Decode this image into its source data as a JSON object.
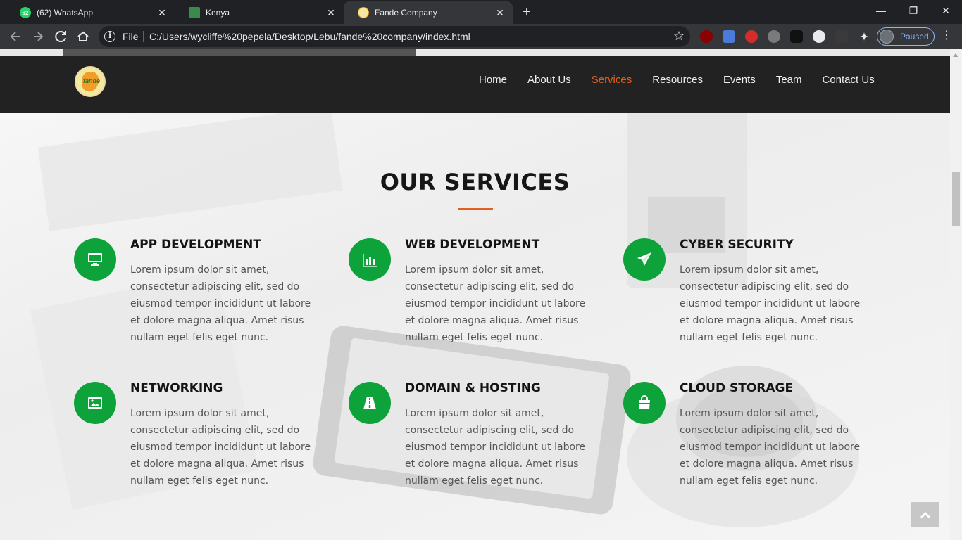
{
  "browser": {
    "tabs": [
      {
        "title": "(62) WhatsApp",
        "favicon": "whatsapp-icon",
        "badge": "62",
        "active": false
      },
      {
        "title": "Kenya",
        "favicon": "kenya-icon",
        "active": false
      },
      {
        "title": "Fande Company",
        "favicon": "fande-icon",
        "active": true
      }
    ],
    "new_tab": "+",
    "window_controls": {
      "minimize": "—",
      "restore": "❐",
      "close": "✕"
    },
    "omnibox": {
      "scheme_label": "File",
      "url": "C:/Users/wycliffe%20pepela/Desktop/Lebu/fande%20company/index.html"
    },
    "profile": {
      "status": "Paused"
    }
  },
  "site": {
    "nav": {
      "items": [
        "Home",
        "About Us",
        "Services",
        "Resources",
        "Events",
        "Team",
        "Contact Us"
      ],
      "active": "Services"
    },
    "logo_text": "fande",
    "section_title": "OUR SERVICES",
    "services": [
      {
        "title": "APP DEVELOPMENT",
        "icon": "monitor-icon",
        "text": "Lorem ipsum dolor sit amet, consectetur adipiscing elit, sed do eiusmod tempor incididunt ut labore et dolore magna aliqua. Amet risus nullam eget felis eget nunc."
      },
      {
        "title": "WEB DEVELOPMENT",
        "icon": "bar-chart-icon",
        "text": "Lorem ipsum dolor sit amet, consectetur adipiscing elit, sed do eiusmod tempor incididunt ut labore et dolore magna aliqua. Amet risus nullam eget felis eget nunc."
      },
      {
        "title": "CYBER SECURITY",
        "icon": "paper-plane-icon",
        "text": "Lorem ipsum dolor sit amet, consectetur adipiscing elit, sed do eiusmod tempor incididunt ut labore et dolore magna aliqua. Amet risus nullam eget felis eget nunc."
      },
      {
        "title": "NETWORKING",
        "icon": "image-icon",
        "text": "Lorem ipsum dolor sit amet, consectetur adipiscing elit, sed do eiusmod tempor incididunt ut labore et dolore magna aliqua. Amet risus nullam eget felis eget nunc."
      },
      {
        "title": "DOMAIN & HOSTING",
        "icon": "road-icon",
        "text": "Lorem ipsum dolor sit amet, consectetur adipiscing elit, sed do eiusmod tempor incididunt ut labore et dolore magna aliqua. Amet risus nullam eget felis eget nunc."
      },
      {
        "title": "CLOUD STORAGE",
        "icon": "shopping-bag-icon",
        "text": "Lorem ipsum dolor sit amet, consectetur adipiscing elit, sed do eiusmod tempor incididunt ut labore et dolore magna aliqua. Amet risus nullam eget felis eget nunc."
      }
    ],
    "colors": {
      "accent": "#e0601e",
      "icon_green": "#0ea33a",
      "nav_bg": "#222222"
    }
  }
}
